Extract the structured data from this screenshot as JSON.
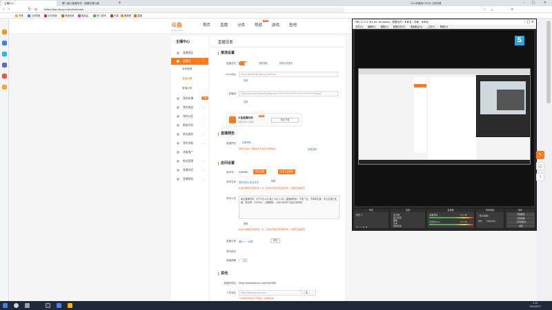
{
  "browser": {
    "tabs": [
      {
        "label": "主播中心"
      },
      {
        "label": "第一届斗鱼嘉年华 - 我要去看斗鱼"
      }
    ],
    "url": "https://tsp.douyu.com/live/main",
    "right_text": "24小时最新2765元 立即查看"
  },
  "bookmarks": [
    "书签",
    "上网导航",
    "京东商城",
    "淘宝特卖",
    "唯品会",
    "热门游戏",
    "天猫",
    "看视频",
    "直播"
  ],
  "site": {
    "logo": "斗鱼",
    "logo_sub": "douyu.com",
    "nav": [
      "首页",
      "直播",
      "分类",
      "视频",
      "游戏",
      "鱼吧"
    ],
    "nav_badge": "NEW"
  },
  "side_menu": {
    "title": "主播中心",
    "items": [
      {
        "label": "直播预告"
      },
      {
        "label": "直播间"
      },
      {
        "label": "我的私播"
      },
      {
        "label": "我的收益"
      },
      {
        "label": "我的公会"
      },
      {
        "label": "数据分析"
      },
      {
        "label": "商业服务"
      },
      {
        "label": "我的技能"
      },
      {
        "label": "流量推广"
      },
      {
        "label": "粉丝管理"
      },
      {
        "label": "直播伴侣"
      },
      {
        "label": "直播帮助"
      }
    ],
    "subs": [
      "房间管理",
      "直播设置",
      "直播记录"
    ],
    "badge": "下载"
  },
  "main": {
    "page_title": "直播设置",
    "push": {
      "section": "推流设置",
      "live_switch_label": "直播开关",
      "btn_apply": "重新获取",
      "btn_mobile": "获取手机推流",
      "rtmp_label": "rtmp地址",
      "rtmp_value": "rtmp://sendfc3a.douyu.com/live",
      "code_label": "直播码",
      "code_value": "5285552mkuD7O9m5?wsSecret=**********************************&wsT",
      "copy": "复制",
      "copy2": "复制",
      "assist_title": "斗鱼直播伙伴",
      "assist_desc": "完美支持ios直播",
      "assist_tag": "NEW",
      "download": "前往下载"
    },
    "notice": {
      "section": "直播预告",
      "label": "直播预告",
      "btn": "设置预告",
      "tip": "预告为空时，直播间将不会显示预告信息",
      "link": "查看说明"
    },
    "room": {
      "section": "房间设置",
      "id_label": "房间号：",
      "id_value": "528585",
      "btn_apply_live": "申请主播",
      "btn_verify": "实名认证信息",
      "name_label": "房间名称",
      "name_value": "带你去看斗鱼嘉年华",
      "name_edit": "修改",
      "name_tip": "房间标题每天仅能修改一次，标题中不能出现违规字样，请遵守直播规范",
      "intro_label": "房间公告",
      "intro_value": "每天直播时间：中午2点-5点 晚上 8点-11点，直播间规则：不发广告，不辱骂主播，关注主播不迷路，粉丝群：528585，主播微博：斗鱼528585 欢迎大家来玩",
      "intro_edit": "修改",
      "intro_tip": "房间公告每天仅能修改一次，公告中不能出现违规字样，请遵守直播规范",
      "cat_label": "直播分类",
      "cat_value": "娱乐 > 一起看",
      "cat_edit": "修改",
      "switch1_label": "房间锁定",
      "switch2_label": "直播提醒"
    },
    "other": {
      "section": "其他",
      "share_label": "直播间地址",
      "share_value": "https://www.douyu.com/528585",
      "jump_label": "个性域名",
      "jump_value": "http://www.douyu.com/",
      "jump_select": "无",
      "jump_tip": "个性域名申请后不可更改，请谨慎设置"
    }
  },
  "obs": {
    "title": "OBS 27.0.1 (64-bit, windows) - 配置文件：未命名 - 场景：未命名",
    "menu": [
      "文件(F)",
      "编辑(E)",
      "视图(V)",
      "配置文件(P)",
      "场景集合(S)",
      "工具(T)",
      "帮助(H)"
    ],
    "docks": {
      "scenes": "场景",
      "sources": "来源",
      "mixer": "混音器",
      "transitions": "转场特效",
      "controls": "控件"
    },
    "scene_item": "场景 2",
    "sources": [
      "显示器",
      "窗口采集",
      "图像",
      "文本",
      "视频采集"
    ],
    "mixer_tracks": [
      {
        "name": "桌面音频",
        "level": "0.0 dB"
      },
      {
        "name": "麦克风/Aux",
        "level": "0.0 dB"
      }
    ],
    "transition": "淡入淡出",
    "duration_label": "时长",
    "duration": "300 ms",
    "controls": [
      "开始推流",
      "开始录制",
      "工作室模式",
      "设置",
      "退出"
    ]
  },
  "taskbar": {
    "time": "2:10",
    "date": "2022/2/17"
  },
  "colors": {
    "accent": "#ff7a1a",
    "link": "#2b78e4"
  }
}
